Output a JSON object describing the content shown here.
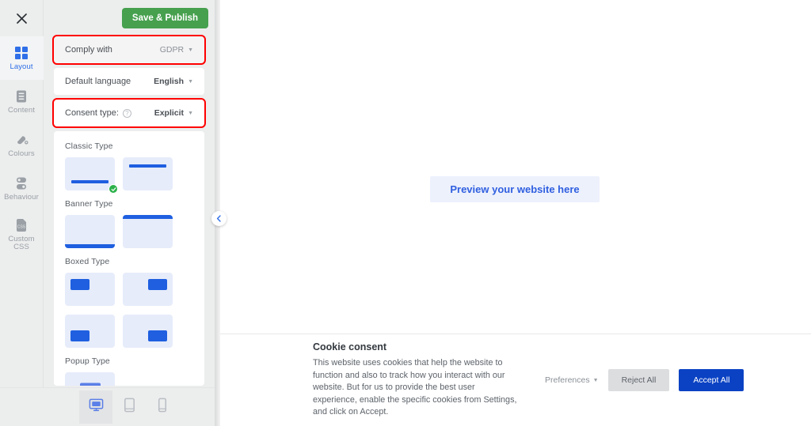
{
  "rail": {
    "close_icon": "close-icon",
    "items": [
      {
        "label": "Layout",
        "icon": "grid-icon",
        "active": true
      },
      {
        "label": "Content",
        "icon": "document-icon",
        "active": false
      },
      {
        "label": "Colours",
        "icon": "paint-drop-icon",
        "active": false
      },
      {
        "label": "Behaviour",
        "icon": "toggle-icon",
        "active": false
      },
      {
        "label": "Custom CSS",
        "icon": "css-file-icon",
        "active": false
      }
    ]
  },
  "panel": {
    "publish_button": "Save & Publish",
    "settings": [
      {
        "label": "Comply with",
        "value": "GDPR",
        "highlighted": true
      },
      {
        "label": "Default language",
        "value": "English",
        "highlighted": false
      },
      {
        "label": "Consent type:",
        "value": "Explicit",
        "highlighted": true,
        "has_help": true
      }
    ],
    "type_groups": [
      {
        "title": "Classic Type",
        "thumbs": [
          {
            "variant": "classic-bottom",
            "selected": true
          },
          {
            "variant": "classic-top",
            "selected": false
          }
        ]
      },
      {
        "title": "Banner Type",
        "thumbs": [
          {
            "variant": "banner-bottom",
            "selected": false
          },
          {
            "variant": "banner-top",
            "selected": false
          }
        ]
      },
      {
        "title": "Boxed Type",
        "thumbs": [
          {
            "variant": "boxed-top-left",
            "selected": false
          },
          {
            "variant": "boxed-top-right",
            "selected": false
          },
          {
            "variant": "boxed-bottom-left",
            "selected": false
          },
          {
            "variant": "boxed-bottom-right",
            "selected": false
          }
        ]
      },
      {
        "title": "Popup Type",
        "thumbs": [
          {
            "variant": "popup-center",
            "selected": false
          }
        ]
      }
    ]
  },
  "devices": [
    {
      "name": "desktop",
      "icon": "desktop-icon",
      "active": true
    },
    {
      "name": "tablet",
      "icon": "tablet-icon",
      "active": false
    },
    {
      "name": "mobile",
      "icon": "mobile-icon",
      "active": false
    }
  ],
  "collapse_icon": "chevron-left-icon",
  "stage": {
    "preview_placeholder": "Preview your website here"
  },
  "consent": {
    "title": "Cookie consent",
    "body": "This website uses cookies that help the website to function and also to track how you interact with our website. But for us to provide the best user experience, enable the specific cookies from Settings, and click on Accept.",
    "preferences_label": "Preferences",
    "reject_label": "Reject All",
    "accept_label": "Accept All"
  },
  "colors": {
    "publish_green": "#46a04e",
    "accent_blue": "#1f5fe0",
    "accept_blue": "#0b42c4",
    "highlight_red": "#ff0000",
    "check_green": "#2bb14a"
  }
}
